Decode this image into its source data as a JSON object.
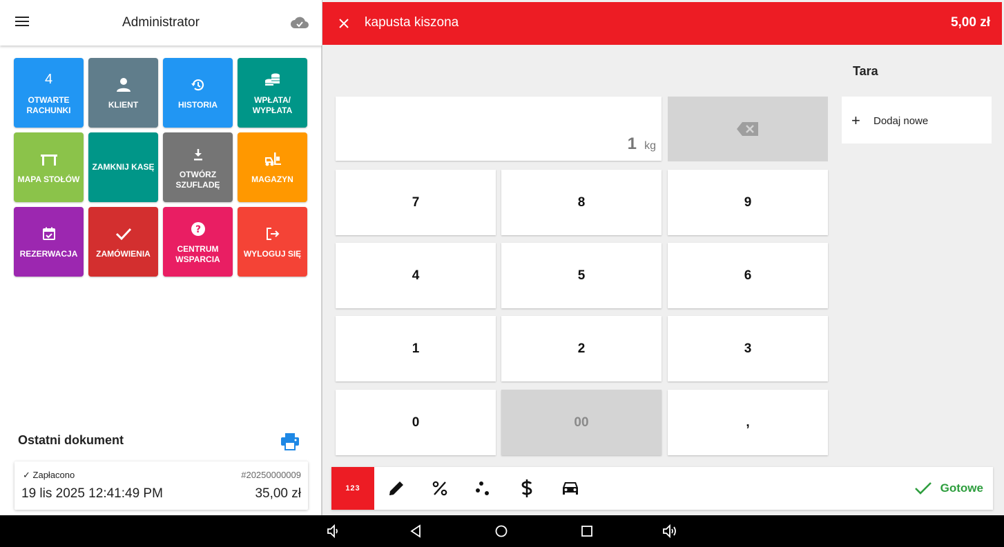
{
  "header": {
    "title": "Administrator"
  },
  "tiles": [
    {
      "id": "open-bills",
      "count": "4",
      "label": "OTWARTE RACHUNKI",
      "color": "#2196f3",
      "icon": "number-icon"
    },
    {
      "id": "client",
      "label": "KLIENT",
      "color": "#607d8b",
      "icon": "person-icon"
    },
    {
      "id": "history",
      "label": "HISTORIA",
      "color": "#2196f3",
      "icon": "history-icon"
    },
    {
      "id": "cash-in-out",
      "label": "WPŁATA/ WYPŁATA",
      "color": "#009688",
      "icon": "coins-icon"
    },
    {
      "id": "table-map",
      "label": "MAPA STOŁÓW",
      "color": "#8bc34a",
      "icon": "table-icon"
    },
    {
      "id": "close-register",
      "label": "ZAMKNIJ KASĘ",
      "color": "#009688",
      "icon": "none"
    },
    {
      "id": "open-drawer",
      "label": "OTWÓRZ SZUFLADĘ",
      "color": "#757575",
      "icon": "download-icon"
    },
    {
      "id": "warehouse",
      "label": "MAGAZYN",
      "color": "#ff9800",
      "icon": "forklift-icon"
    },
    {
      "id": "reservation",
      "label": "REZERWACJA",
      "color": "#9c27b0",
      "icon": "calendar-check-icon"
    },
    {
      "id": "orders",
      "label": "ZAMÓWIENIA",
      "color": "#d32f2f",
      "icon": "check-icon"
    },
    {
      "id": "support",
      "label": "CENTRUM WSPARCIA",
      "color": "#e91e63",
      "icon": "help-icon"
    },
    {
      "id": "logout",
      "label": "WYLOGUJ SIĘ",
      "color": "#f44336",
      "icon": "logout-icon"
    }
  ],
  "last_document": {
    "title": "Ostatni dokument",
    "status": "Zapłacono",
    "number": "#20250000009",
    "date": "19 lis 2025 12:41:49 PM",
    "amount": "35,00 zł"
  },
  "product": {
    "name": "kapusta kiszona",
    "price": "5,00 zł"
  },
  "display": {
    "value": "1",
    "unit": "kg"
  },
  "keypad": {
    "k7": "7",
    "k8": "8",
    "k9": "9",
    "k4": "4",
    "k5": "5",
    "k6": "6",
    "k1": "1",
    "k2": "2",
    "k3": "3",
    "k0": "0",
    "k00": "00",
    "kcomma": ","
  },
  "tara": {
    "title": "Tara",
    "add_label": "Dodaj nowe"
  },
  "toolbar": {
    "numeric_label": "123",
    "done_label": "Gotowe"
  },
  "colors": {
    "accent_red": "#ed1c24",
    "done_green": "#2e9e3e",
    "print_blue": "#1e88e5"
  }
}
